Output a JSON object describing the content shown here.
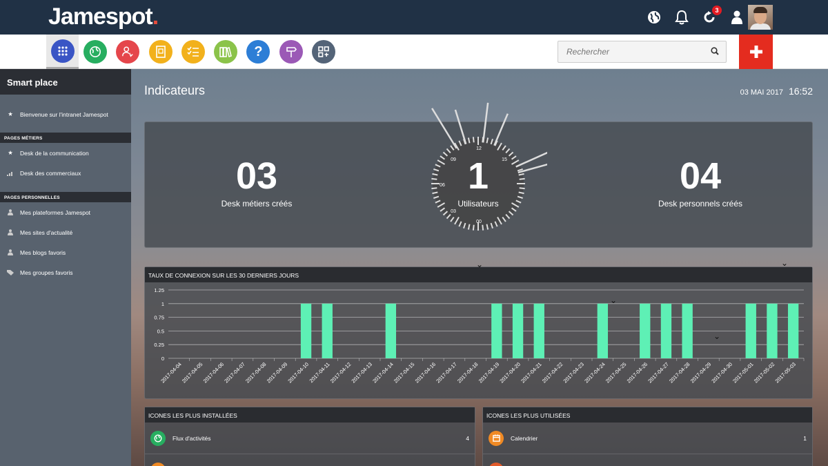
{
  "topbar": {
    "logo": "Jamespot",
    "logo_dot": ".",
    "notification_count": "3",
    "icons": [
      "globe-icon",
      "bell-icon",
      "refresh-icon",
      "user-icon",
      "dashboard-icon"
    ]
  },
  "appbar": {
    "apps": [
      {
        "name": "apps-grid",
        "color": "#3a55c5"
      },
      {
        "name": "globe",
        "color": "#27ae60"
      },
      {
        "name": "contacts",
        "color": "#e5464b"
      },
      {
        "name": "directory",
        "color": "#f2b11c"
      },
      {
        "name": "tasks",
        "color": "#f2b11c"
      },
      {
        "name": "library",
        "color": "#8bc34a"
      },
      {
        "name": "help",
        "color": "#2d7ed6"
      },
      {
        "name": "signpost",
        "color": "#9b59b6"
      },
      {
        "name": "widgets",
        "color": "#546478"
      }
    ],
    "search_placeholder": "Rechercher"
  },
  "sidebar": {
    "title": "Smart place",
    "welcome": "Bienvenue sur l'intranet Jamespot",
    "section_metiers": "PAGES MÉTIERS",
    "metiers": [
      "Desk de la communication",
      "Desk des commerciaux"
    ],
    "section_perso": "PAGES PERSONNELLES",
    "perso": [
      "Mes plateformes Jamespot",
      "Mes sites d'actualité",
      "Mes blogs favoris",
      "Mes groupes favoris"
    ]
  },
  "main": {
    "title": "Indicateurs",
    "date": "03 MAI 2017",
    "time": "16:52"
  },
  "stats": {
    "desk_metiers": {
      "value": "03",
      "label": "Desk métiers créés"
    },
    "users": {
      "value": "1",
      "label": "Utilisateurs"
    },
    "desk_perso": {
      "value": "04",
      "label": "Desk personnels créés"
    },
    "dial_labels": [
      "12",
      "15",
      "09",
      "06",
      "03",
      "00"
    ]
  },
  "chart_data": {
    "type": "bar",
    "title": "TAUX DE CONNEXION SUR LES 30 DERNIERS JOURS",
    "categories": [
      "2017-04-04",
      "2017-04-05",
      "2017-04-06",
      "2017-04-07",
      "2017-04-08",
      "2017-04-09",
      "2017-04-10",
      "2017-04-11",
      "2017-04-12",
      "2017-04-13",
      "2017-04-14",
      "2017-04-15",
      "2017-04-16",
      "2017-04-17",
      "2017-04-18",
      "2017-04-19",
      "2017-04-20",
      "2017-04-21",
      "2017-04-22",
      "2017-04-23",
      "2017-04-24",
      "2017-04-25",
      "2017-04-26",
      "2017-04-27",
      "2017-04-28",
      "2017-04-29",
      "2017-04-30",
      "2017-05-01",
      "2017-05-02",
      "2017-05-03"
    ],
    "values": [
      0,
      0,
      0,
      0,
      0,
      0,
      1,
      1,
      0,
      0,
      1,
      0,
      0,
      0,
      0,
      1,
      1,
      1,
      0,
      0,
      1,
      0,
      1,
      1,
      1,
      0,
      0,
      1,
      1,
      1
    ],
    "yticks": [
      "1.25",
      "1",
      "0.75",
      "0.5",
      "0.25",
      "0"
    ],
    "ylim": [
      0,
      1.25
    ],
    "bar_color": "#5ef0b5",
    "grid": true
  },
  "installed": {
    "title": "ICONES LES PLUS INSTALLÉES",
    "rows": [
      {
        "label": "Flux d'activités",
        "value": "4",
        "color": "#27ae60"
      }
    ]
  },
  "used": {
    "title": "ICONES LES PLUS UTILISÉES",
    "rows": [
      {
        "label": "Calendrier",
        "value": "1",
        "color": "#f08a24"
      }
    ]
  }
}
